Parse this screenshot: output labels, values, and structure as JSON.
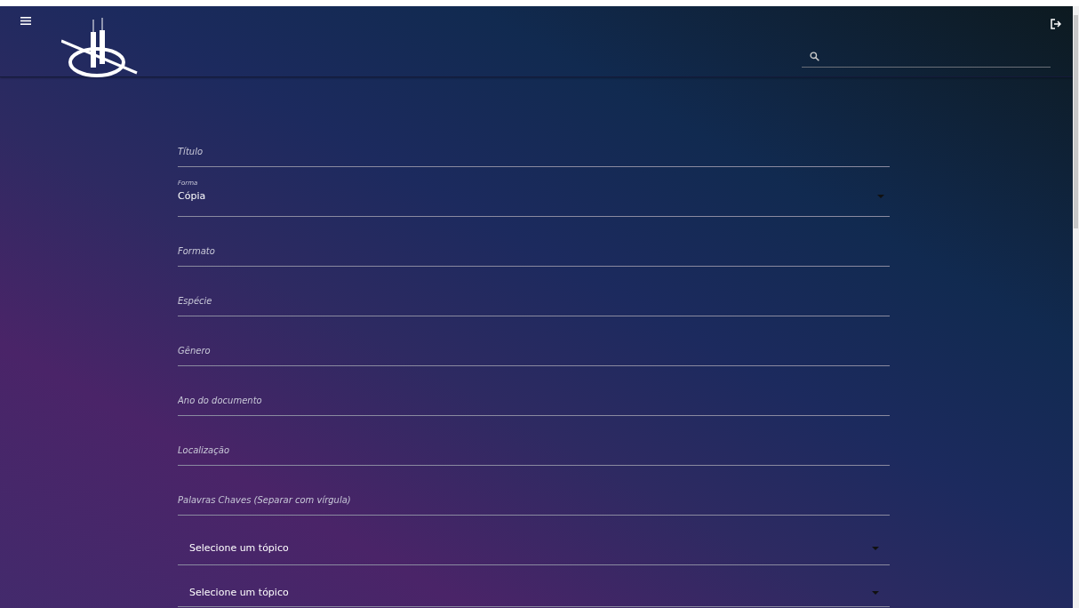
{
  "form": {
    "fields": [
      {
        "kind": "text",
        "placeholder": "Título"
      },
      {
        "kind": "select",
        "label": "Forma",
        "value": "Cópia"
      },
      {
        "kind": "text",
        "placeholder": "Formato"
      },
      {
        "kind": "text",
        "placeholder": "Espécie"
      },
      {
        "kind": "text",
        "placeholder": "Gênero"
      },
      {
        "kind": "text",
        "placeholder": "Ano do documento"
      },
      {
        "kind": "text",
        "placeholder": "Localização"
      },
      {
        "kind": "text",
        "placeholder": "Palavras Chaves (Separar com vírgula)"
      },
      {
        "kind": "topic",
        "value": "Selecione um tópico"
      },
      {
        "kind": "topic",
        "value": "Selecione um tópico"
      }
    ]
  }
}
